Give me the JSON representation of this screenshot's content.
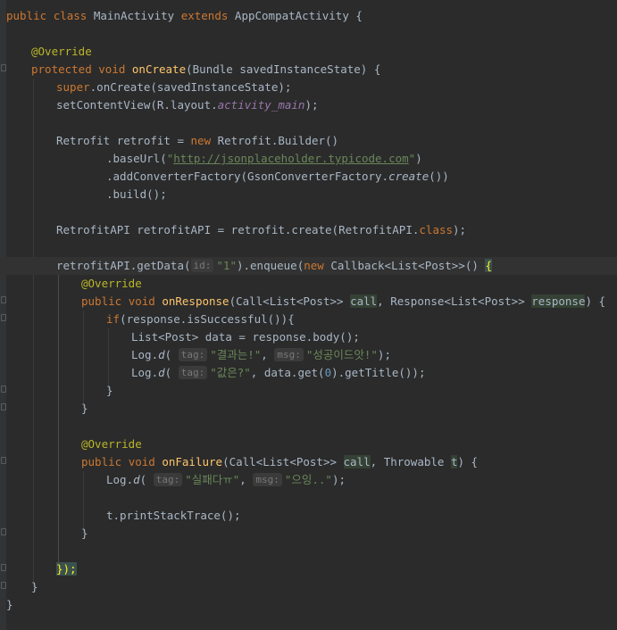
{
  "code": {
    "class_decl": {
      "kw_public": "public",
      "kw_class": "class",
      "name": "MainActivity",
      "kw_extends": "extends",
      "parent": "AppCompatActivity",
      "brace": " {"
    },
    "override_1": "@Override",
    "oncreate_decl": {
      "kw_protected": "protected",
      "kw_void": "void",
      "name": "onCreate",
      "params": "(Bundle savedInstanceState) {"
    },
    "super_call": {
      "kw": "super",
      "rest": ".onCreate(savedInstanceState);"
    },
    "setcontent": {
      "pre": "setContentView(R.layout.",
      "field": "activity_main",
      "post": ");"
    },
    "retrofit_decl": {
      "pre": "Retrofit retrofit = ",
      "kw_new": "new",
      "post": " Retrofit.Builder()"
    },
    "baseurl": {
      "pre": ".baseUrl(",
      "q1": "\"",
      "url": "http://jsonplaceholder.typicode.com",
      "q2": "\"",
      "post": ")"
    },
    "converter": {
      "pre": ".addConverterFactory(GsonConverterFactory.",
      "method": "create",
      "post": "())"
    },
    "build": ".build();",
    "api_decl": {
      "pre": "RetrofitAPI retrofitAPI = retrofit.create(RetrofitAPI.",
      "kw_class": "class",
      "post": ");"
    },
    "getdata": {
      "pre": "retrofitAPI.getData(",
      "hint": "id:",
      "arg": "\"1\"",
      "mid": ").enqueue(",
      "kw_new": "new",
      "type": " Callback<List<Post>>() ",
      "brace": "{"
    },
    "override_2": "@Override",
    "onresponse_decl": {
      "kw_public": "public",
      "kw_void": "void",
      "name": "onResponse",
      "p1": "(Call<List<Post>> ",
      "call": "call",
      "p2": ", Response<List<Post>> ",
      "response": "response",
      "p3": ") {"
    },
    "if_line": {
      "kw_if": "if",
      "rest": "(response.isSuccessful()){"
    },
    "list_line": "List<Post> data = response.body();",
    "log1": {
      "pre": "Log.",
      "d": "d",
      "open": "(",
      "hint_tag": "tag:",
      "tag": "\"결과는!\"",
      "comma": ", ",
      "hint_msg": "msg:",
      "msg": "\"성공이드앗!\"",
      "close": ");"
    },
    "log2": {
      "pre": "Log.",
      "d": "d",
      "open": "(",
      "hint_tag": "tag:",
      "tag": "\"값은?\"",
      "mid": ", data.get(",
      "num": "0",
      "post": ").getTitle());"
    },
    "close_if": "}",
    "close_onresponse": "}",
    "override_3": "@Override",
    "onfailure_decl": {
      "kw_public": "public",
      "kw_void": "void",
      "name": "onFailure",
      "p1": "(Call<List<Post>> ",
      "call": "call",
      "p2": ", Throwable ",
      "t": "t",
      "p3": ") {"
    },
    "log3": {
      "pre": "Log.",
      "d": "d",
      "open": "(",
      "hint_tag": "tag:",
      "tag": "\"실패다ㅠ\"",
      "comma": ", ",
      "hint_msg": "msg:",
      "msg": "\"으잉..\"",
      "close": ");"
    },
    "stacktrace": "t.printStackTrace();",
    "close_onfailure": "}",
    "close_callback": "});",
    "close_oncreate": "}",
    "close_class": "}"
  }
}
